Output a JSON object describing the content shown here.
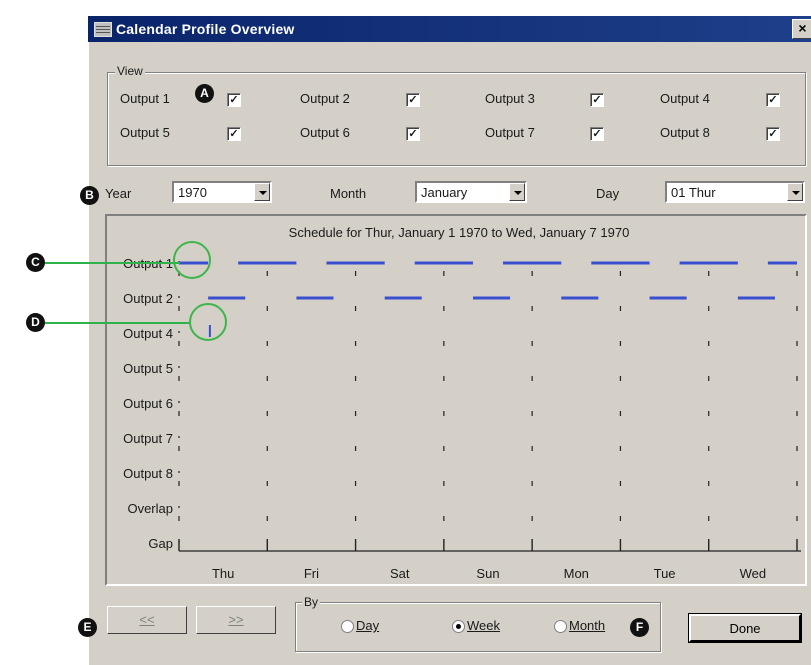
{
  "window": {
    "title": "Calendar Profile Overview",
    "close_glyph": "×"
  },
  "view_group": {
    "legend": "View",
    "outputs": [
      {
        "label": "Output 1",
        "checked": true
      },
      {
        "label": "Output 2",
        "checked": true
      },
      {
        "label": "Output 3",
        "checked": true
      },
      {
        "label": "Output 4",
        "checked": true
      },
      {
        "label": "Output 5",
        "checked": true
      },
      {
        "label": "Output 6",
        "checked": true
      },
      {
        "label": "Output 7",
        "checked": true
      },
      {
        "label": "Output 8",
        "checked": true
      }
    ],
    "check_glyph": "✓"
  },
  "selectors": {
    "year_label": "Year",
    "year_value": "1970",
    "month_label": "Month",
    "month_value": "January",
    "day_label": "Day",
    "day_value": "01 Thur"
  },
  "schedule": {
    "title": "Schedule for Thur, January 1 1970 to Wed, January 7 1970",
    "rows": [
      "Output 1",
      "Output 2",
      "Output 4",
      "Output 5",
      "Output 6",
      "Output 7",
      "Output 8",
      "Overlap",
      "Gap"
    ],
    "days": [
      "Thu",
      "Fri",
      "Sat",
      "Sun",
      "Mon",
      "Tue",
      "Wed"
    ],
    "line_color": "#3a4fd0",
    "output1_segments": [
      [
        0.0,
        0.33
      ],
      [
        0.67,
        1.33
      ],
      [
        1.67,
        2.33
      ],
      [
        2.67,
        3.33
      ],
      [
        3.67,
        4.33
      ],
      [
        4.67,
        5.33
      ],
      [
        5.67,
        6.33
      ],
      [
        6.67,
        7.0
      ]
    ],
    "output2_segments": [
      [
        0.33,
        0.75
      ],
      [
        1.33,
        1.75
      ],
      [
        2.33,
        2.75
      ],
      [
        3.33,
        3.75
      ],
      [
        4.33,
        4.75
      ],
      [
        5.33,
        5.75
      ],
      [
        6.33,
        6.75
      ]
    ],
    "output4_events": [
      0.35
    ]
  },
  "nav": {
    "prev_label": "<<",
    "next_label": ">>",
    "by_legend": "By",
    "by_options": [
      {
        "label": "Day",
        "selected": false
      },
      {
        "label": "Week",
        "selected": true
      },
      {
        "label": "Month",
        "selected": false
      }
    ],
    "done_label": "Done"
  },
  "callouts": {
    "a": "A",
    "b": "B",
    "c": "C",
    "d": "D",
    "e": "E",
    "f": "F",
    "accent_color": "#3cb54b"
  }
}
